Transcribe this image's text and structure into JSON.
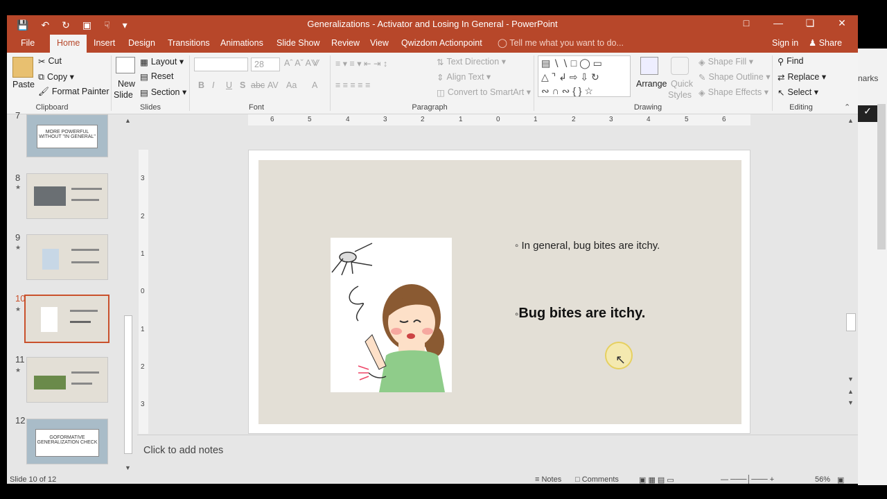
{
  "window": {
    "title": "Generalizations - Activator and Losing In General  -  PowerPoint"
  },
  "ribbon_tabs": [
    "File",
    "Home",
    "Insert",
    "Design",
    "Transitions",
    "Animations",
    "Slide Show",
    "Review",
    "View",
    "Qwizdom Actionpoint"
  ],
  "tell_me": "Tell me what you want to do...",
  "sign_in": "Sign in",
  "share": "Share",
  "clipboard": {
    "paste": "Paste",
    "cut": "Cut",
    "copy": "Copy",
    "format_painter": "Format Painter",
    "label": "Clipboard"
  },
  "slides_group": {
    "new_slide_1": "New",
    "new_slide_2": "Slide",
    "layout": "Layout",
    "reset": "Reset",
    "section": "Section",
    "label": "Slides"
  },
  "font_group": {
    "size": "28",
    "bold": "B",
    "italic": "I",
    "underline": "U",
    "shadow": "S",
    "strike": "abc",
    "spacing": "AV",
    "case": "Aa",
    "label": "Font"
  },
  "paragraph_group": {
    "text_direction": "Text Direction",
    "align_text": "Align Text",
    "convert": "Convert to SmartArt",
    "label": "Paragraph"
  },
  "drawing_group": {
    "arrange": "Arrange",
    "quick_styles_1": "Quick",
    "quick_styles_2": "Styles",
    "shape_fill": "Shape Fill",
    "shape_outline": "Shape Outline",
    "shape_effects": "Shape Effects",
    "label": "Drawing"
  },
  "editing_group": {
    "find": "Find",
    "replace": "Replace",
    "select": "Select",
    "label": "Editing"
  },
  "thumbnails": [
    {
      "num": "7",
      "text": "MORE POWERFUL WITHOUT \"IN GENERAL\""
    },
    {
      "num": "8"
    },
    {
      "num": "9"
    },
    {
      "num": "10"
    },
    {
      "num": "11"
    },
    {
      "num": "12",
      "text": "GOFORMATIVE GENERALIZATION CHECK"
    }
  ],
  "ruler_h": [
    "6",
    "5",
    "4",
    "3",
    "2",
    "1",
    "0",
    "1",
    "2",
    "3",
    "4",
    "5",
    "6"
  ],
  "ruler_v": [
    "3",
    "2",
    "1",
    "0",
    "1",
    "2",
    "3"
  ],
  "slide": {
    "bullet1": "In general, bug bites are itchy.",
    "bullet2": "Bug bites are itchy."
  },
  "notes_placeholder": "Click to add notes",
  "status": {
    "slide_info": "Slide 10 of 12",
    "notes": "Notes",
    "comments": "Comments",
    "zoom": "56%"
  },
  "side_text": "narks"
}
